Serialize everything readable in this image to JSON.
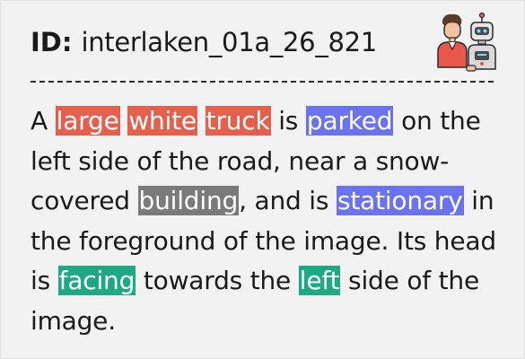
{
  "header": {
    "id_label": "ID:",
    "id_value": "interlaken_01a_26_821",
    "avatar_icon": "human-and-robot-icon"
  },
  "caption": {
    "segments": [
      {
        "text": "A ",
        "highlight": null
      },
      {
        "text": "large",
        "highlight": "#e4604d"
      },
      {
        "text": " ",
        "highlight": null
      },
      {
        "text": "white",
        "highlight": "#e4604d"
      },
      {
        "text": " ",
        "highlight": null
      },
      {
        "text": "truck",
        "highlight": "#e4604d"
      },
      {
        "text": " is ",
        "highlight": null
      },
      {
        "text": "parked",
        "highlight": "#6b72f0"
      },
      {
        "text": " on the left side of the road, near a snow-covered ",
        "highlight": null
      },
      {
        "text": "building",
        "highlight": "#7a7a7a"
      },
      {
        "text": ", and is ",
        "highlight": null
      },
      {
        "text": "stationary",
        "highlight": "#6b72f0"
      },
      {
        "text": " in the foreground of the image. Its head is ",
        "highlight": null
      },
      {
        "text": "facing",
        "highlight": "#1fa884"
      },
      {
        "text": " towards the ",
        "highlight": null
      },
      {
        "text": "left",
        "highlight": "#1fa884"
      },
      {
        "text": " side of the image.",
        "highlight": null
      }
    ]
  },
  "colors": {
    "attribute": "#e4604d",
    "action": "#6b72f0",
    "context": "#7a7a7a",
    "direction": "#1fa884",
    "background": "#f2f2f2"
  }
}
